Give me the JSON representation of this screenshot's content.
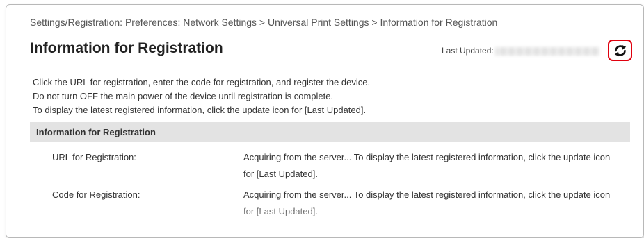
{
  "breadcrumb": "Settings/Registration: Preferences: Network Settings > Universal Print Settings > Information for Registration",
  "page": {
    "title": "Information for Registration",
    "last_updated_label": "Last Updated:",
    "refresh_icon": "refresh-icon",
    "refresh_highlight_color": "#e0000e"
  },
  "notes": [
    "Click the URL for registration, enter the code for registration, and register the device.",
    "Do not turn OFF the main power of the device until registration is complete.",
    "To display the latest registered information, click the update icon for [Last Updated]."
  ],
  "section": {
    "title": "Information for Registration",
    "rows": [
      {
        "label": "URL for Registration:",
        "value": "Acquiring from the server... To display the latest registered information, click the update icon for [Last Updated]."
      },
      {
        "label": "Code for Registration:",
        "value": "Acquiring from the server... To display the latest registered information, click the update icon for [Last Updated]."
      }
    ]
  }
}
